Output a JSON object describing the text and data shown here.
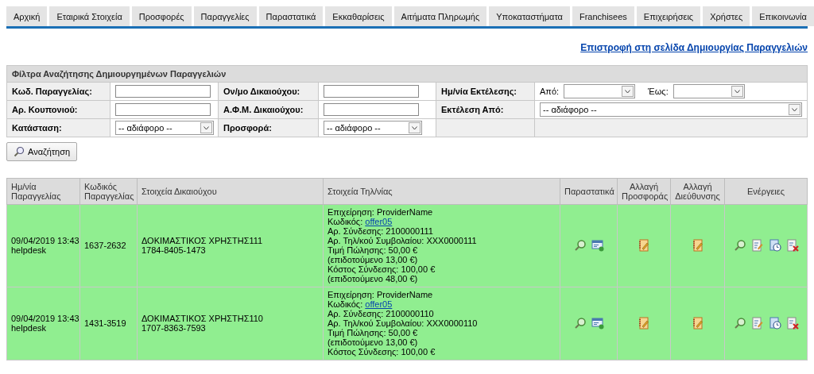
{
  "tabs": [
    {
      "label": "Αρχική",
      "selected": false
    },
    {
      "label": "Εταιρικά Στοιχεία",
      "selected": false
    },
    {
      "label": "Προσφορές",
      "selected": false
    },
    {
      "label": "Παραγγελίες",
      "selected": false
    },
    {
      "label": "Παραστατικά",
      "selected": false
    },
    {
      "label": "Εκκαθαρίσεις",
      "selected": false
    },
    {
      "label": "Αιτήματα Πληρωμής",
      "selected": false
    },
    {
      "label": "Υποκαταστήματα",
      "selected": false
    },
    {
      "label": "Franchisees",
      "selected": false
    },
    {
      "label": "Επιχειρήσεις",
      "selected": false
    },
    {
      "label": "Χρήστες",
      "selected": false
    },
    {
      "label": "Επικοινωνία",
      "selected": false
    }
  ],
  "back_link": "Επιστροφή στη σελίδα Δημιουργίας Παραγγελιών",
  "filters": {
    "title": "Φίλτρα Αναζήτησης Δημιουργημένων Παραγγελιών",
    "rows": [
      [
        {
          "kind": "label",
          "text": "Κωδ. Παραγγελίας:"
        },
        {
          "kind": "text"
        },
        {
          "kind": "label",
          "text": "Ον/μο Δικαιούχου:"
        },
        {
          "kind": "text"
        },
        {
          "kind": "label",
          "text": "Ημ/νία Εκτέλεσης:"
        },
        {
          "kind": "range",
          "from": "Από:",
          "to": "Έως:"
        }
      ],
      [
        {
          "kind": "label",
          "text": "Αρ. Κουπονιού:"
        },
        {
          "kind": "text"
        },
        {
          "kind": "label",
          "text": "Α.Φ.Μ. Δικαιούχου:"
        },
        {
          "kind": "text"
        },
        {
          "kind": "label",
          "text": "Εκτέλεση Από:"
        },
        {
          "kind": "select",
          "value": "-- αδιάφορο --"
        }
      ],
      [
        {
          "kind": "label",
          "text": "Κατάσταση:"
        },
        {
          "kind": "select",
          "value": "-- αδιάφορο --"
        },
        {
          "kind": "label",
          "text": "Προσφορά:"
        },
        {
          "kind": "select",
          "value": "-- αδιάφορο --"
        },
        {
          "kind": "empty"
        },
        {
          "kind": "empty"
        }
      ]
    ]
  },
  "search_button": "Αναζήτηση",
  "orders": {
    "columns": [
      "Ημ/νία Παραγγελίας",
      "Κωδικός Παραγγελίας",
      "Στοιχεία Δικαιούχου",
      "Στοιχεία Τηλ/νίας",
      "Παραστατικά",
      "Αλλαγή Προσφοράς",
      "Αλλαγή Διεύθυνσης",
      "Ενέργειες"
    ],
    "rows": [
      {
        "date": "09/04/2019 13:43",
        "user": "helpdesk",
        "code": "1637-2632",
        "beneficiary": "ΔΟΚΙΜΑΣΤΙΚΟΣ ΧΡΗΣΤΗΣ111",
        "beneficiary_id": "1784-8405-1473",
        "details": [
          {
            "text": "Επιχείρηση: ProviderName"
          },
          {
            "text": "Κωδικός:",
            "link": "offer05"
          },
          {
            "text": "Αρ. Σύνδεσης: 2100000111"
          },
          {
            "text": "Αρ. Τηλ/κού Συμβολαίου: XXX0000111"
          },
          {
            "text": "Τιμή Πώλησης: 50,00 €"
          },
          {
            "text": "(επιδοτούμενο 13,00 €)"
          },
          {
            "text": "Κόστος Σύνδεσης: 100,00 €"
          },
          {
            "text": "(επιδοτούμενο 48,00 €)"
          }
        ]
      },
      {
        "date": "09/04/2019 13:43",
        "user": "helpdesk",
        "code": "1431-3519",
        "beneficiary": "ΔΟΚΙΜΑΣΤΙΚΟΣ ΧΡΗΣΤΗΣ110",
        "beneficiary_id": "1707-8363-7593",
        "details": [
          {
            "text": "Επιχείρηση: ProviderName"
          },
          {
            "text": "Κωδικός:",
            "link": "offer05"
          },
          {
            "text": "Αρ. Σύνδεσης: 2100000110"
          },
          {
            "text": "Αρ. Τηλ/κού Συμβολαίου: XXX0000110"
          },
          {
            "text": "Τιμή Πώλησης: 50,00 €"
          },
          {
            "text": "(επιδοτούμενο 13,00 €)"
          },
          {
            "text": "Κόστος Σύνδεσης: 100,00 €"
          }
        ]
      }
    ]
  }
}
